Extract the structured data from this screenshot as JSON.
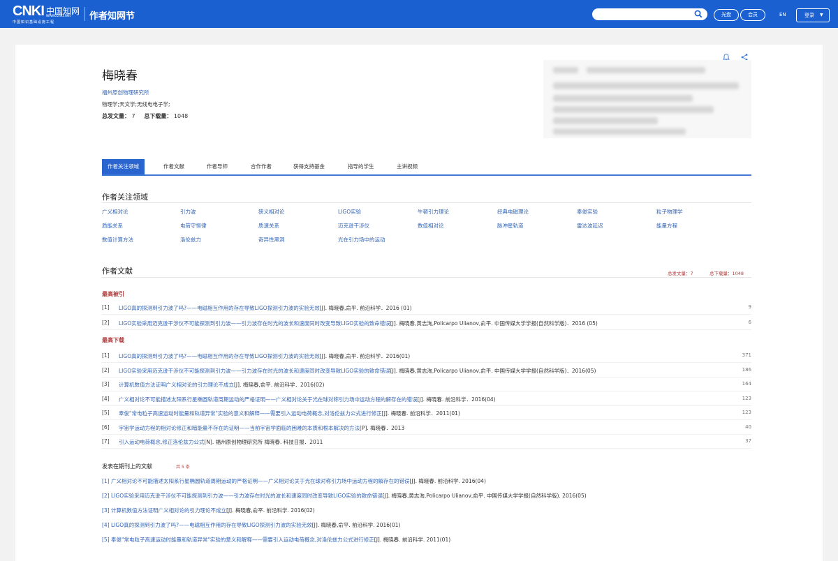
{
  "header": {
    "logo_text": "CNKI",
    "logo_cn": "中国知网",
    "logo_site": "www.cnki.net",
    "logo_sub": "中国知识基础设施工程",
    "channel": "作者知网节",
    "buttons": [
      "光盘",
      "会员"
    ],
    "lang": "EN",
    "login": "登录"
  },
  "author": {
    "name": "梅晓春",
    "institution": "福州原创物理研究所",
    "fields": "物理学;天文学;无线电电子学;",
    "stat_pub_label": "总发文量：",
    "stat_pub_value": "7",
    "stat_dl_label": "总下载量：",
    "stat_dl_value": "1048"
  },
  "tabs": [
    "作者关注领域",
    "作者文献",
    "作者导师",
    "合作作者",
    "获得支持基金",
    "指导的学生",
    "主讲视频"
  ],
  "focus": {
    "title": "作者关注领域",
    "keywords": [
      "广义相对论",
      "引力波",
      "狭义相对论",
      "LIGO实验",
      "牛顿引力理论",
      "经典电磁理论",
      "奉俊实验",
      "粒子物理学",
      "质能关系",
      "电荷守恒律",
      "质速关系",
      "迈克逊干涉仪",
      "数值相对论",
      "脉冲星轨道",
      "雷达波延迟",
      "能量方程",
      "数值计算方法",
      "洛伦兹力",
      "奇异性黑洞",
      "光在引力场中的运动"
    ]
  },
  "works": {
    "title": "作者文献",
    "sum_pub": "总发文量：7",
    "sum_dl": "总下载量：1048",
    "cited_label": "最高被引",
    "cited": [
      {
        "num": "[1]",
        "title": "LIGO真的探测到引力波了吗?——电磁相互作用的存在导致LIGO探测引力波的实验无效",
        "meta": "[J]. 梅晓春,俞平. 前沿科学．2016 (01)",
        "count": "9"
      },
      {
        "num": "[2]",
        "title": "LIGO实验采用迈克逊干涉仪不可能探测到引力波——引力波存在时光的波长和速度同时改变导致LIGO实验的致命错误",
        "meta": "[J]. 梅晓春,黄志洵,Policarpo Ulianov,俞平. 中国传媒大学学报(自然科学版)．2016 (05)",
        "count": "6"
      }
    ],
    "download_label": "最高下载",
    "downloads": [
      {
        "num": "[1]",
        "title": "LIGO真的探测到引力波了吗?——电磁相互作用的存在导致LIGO探测引力波的实验无效",
        "meta": "[J]. 梅晓春,俞平. 前沿科学．2016(01)",
        "count": "371"
      },
      {
        "num": "[2]",
        "title": "LIGO实验采用迈克逊干涉仪不可能探测到引力波——引力波存在时光的波长和速度同时改变导致LIGO实验的致命错误",
        "meta": "[J]. 梅晓春,黄志洵,Policarpo Ulianov,俞平. 中国传媒大学学报(自然科学版)．2016(05)",
        "count": "186"
      },
      {
        "num": "[3]",
        "title": "计算机数值方法证明广义相对论的引力理论不成立",
        "meta": "[J]. 梅晓春,俞平. 前沿科学．2016(02)",
        "count": "164"
      },
      {
        "num": "[4]",
        "title": "广义相对论不可能描述太阳系行星椭圆轨道周期运动的严格证明——广义相对论关于光在球对称引力场中运动方程的解存在的错误",
        "meta": "[J]. 梅晓春. 前沿科学．2016(04)",
        "count": "123"
      },
      {
        "num": "[5]",
        "title": "奉俊\"常电粒子高速运动时能量和轨道异常\"实验的意义和解释——需要引入运动电荷概念,对洛伦兹力公式进行修正",
        "meta": "[J]. 梅晓春. 前沿科学．2011(01)",
        "count": "123"
      },
      {
        "num": "[6]",
        "title": "宇宙学运动方程的相对论修正和暗能量不存在的证明——当前宇宙学面临的困难的本质和根本解决的方法",
        "meta": "[P]. 梅晓春．2013",
        "count": "40"
      },
      {
        "num": "[7]",
        "title": "引入运动电荷概念,修正洛伦兹力公式",
        "meta": "[N]. 福州原创物理研究所 梅晓春. 科技日报．2011",
        "count": "37"
      }
    ]
  },
  "journal": {
    "title": "发表在期刊上的文献",
    "icons": [
      "共",
      "5",
      "条"
    ],
    "items": [
      {
        "title": "[1] 广义相对论不可能描述太阳系行星椭圆轨道周期运动的严格证明——广义相对论关于光在球对称引力场中运动方程的解存在的错误",
        "meta": "[J]. 梅晓春. 前沿科学. 2016(04)"
      },
      {
        "title": "[2] LIGO实验采用迈克逊干涉仪不可能探测到引力波——引力波存在时光的波长和速度同时改变导致LIGO实验的致命错误",
        "meta": "[J]. 梅晓春,黄志洵,Policarpo Ulianov,俞平. 中国传媒大学学报(自然科学版). 2016(05)"
      },
      {
        "title": "[3] 计算机数值方法证明广义相对论的引力理论不成立",
        "meta": "[J]. 梅晓春,俞平. 前沿科学. 2016(02)"
      },
      {
        "title": "[4] LIGO真的探测到引力波了吗?——电磁相互作用的存在导致LIGO探测引力波的实验无效",
        "meta": "[J]. 梅晓春,俞平. 前沿科学. 2016(01)"
      },
      {
        "title": "[5] 奉俊\"常电粒子高速运动时能量和轨道异常\"实验的意义和解释——需要引入运动电荷概念,对洛伦兹力公式进行修正",
        "meta": "[J]. 梅晓春. 前沿科学. 2011(01)"
      }
    ]
  }
}
